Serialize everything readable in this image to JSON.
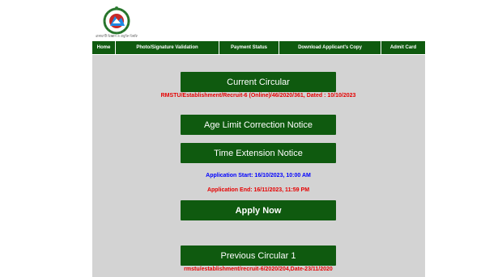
{
  "header": {
    "logo_icon": "university-emblem-icon",
    "logo_caption": "রাঙ্গামাটি বিজ্ঞান ও প্রযুক্তি বিশ্ববিদ্যালয়"
  },
  "nav": {
    "items": [
      {
        "label": "Home"
      },
      {
        "label": "Photo/Signature Validation"
      },
      {
        "label": "Payment Status"
      },
      {
        "label": "Download Applicant's Copy"
      },
      {
        "label": "Admit Card"
      }
    ]
  },
  "main": {
    "current_circular_label": "Current Circular",
    "current_circular_ref": "RMSTU/Establishment/Recruit-6 (Online)/46/2020/361, Dated : 10/10/2023",
    "age_limit_label": "Age Limit Correction Notice",
    "time_extension_label": "Time Extension Notice",
    "application_start": "Application Start: 16/10/2023, 10:00 AM",
    "application_end": "Application End: 16/11/2023, 11:59 PM",
    "apply_now_label": "Apply Now",
    "previous_circular_label": "Previous Circular 1",
    "previous_circular_ref": "rmstu/establishment/recruit-6/2020/204,Date-23/11/2020"
  },
  "colors": {
    "primary_green": "#0f5a0f",
    "alert_red": "#e60000",
    "info_blue": "#0000ff",
    "panel_gray": "#d3d3d3"
  }
}
